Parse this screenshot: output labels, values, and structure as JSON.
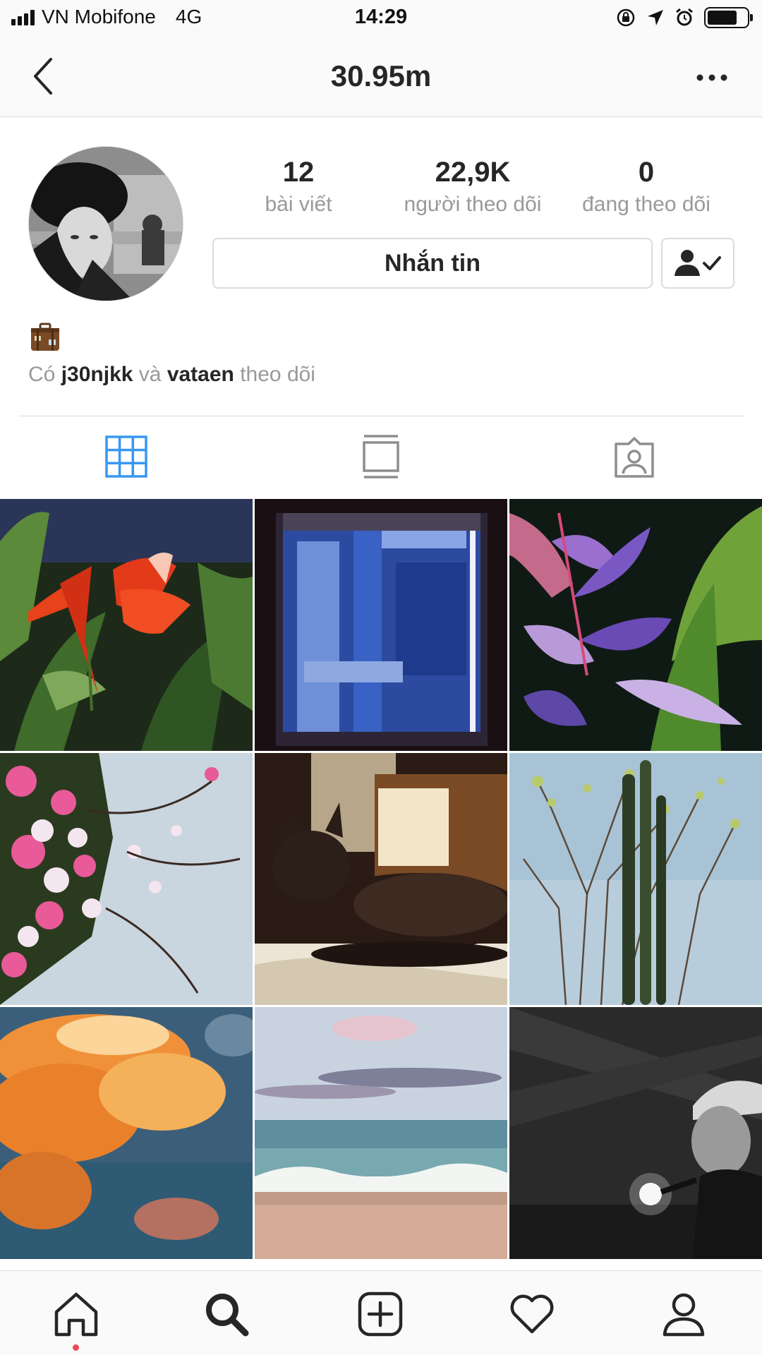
{
  "status_bar": {
    "carrier": "VN Mobifone",
    "network": "4G",
    "time": "14:29",
    "battery_level": 0.75,
    "icons": [
      "orientation-lock-icon",
      "location-arrow-icon",
      "alarm-icon",
      "battery-icon"
    ]
  },
  "nav": {
    "title": "30.95m",
    "back_icon": "chevron-left-icon",
    "more_icon": "more-horizontal-icon"
  },
  "profile": {
    "stats": [
      {
        "value": "12",
        "label": "bài viết"
      },
      {
        "value": "22,9K",
        "label": "người theo dõi"
      },
      {
        "value": "0",
        "label": "đang theo dõi"
      }
    ],
    "message_button": "Nhắn tin",
    "follow_icon": "person-check-icon",
    "bio_icon": "suitcase-icon",
    "followed_by": {
      "prefix": "Có",
      "user1": "j30njkk",
      "joiner": "và",
      "user2": "vataen",
      "suffix": "theo dõi"
    }
  },
  "tabs": [
    {
      "icon": "grid-icon",
      "active": true
    },
    {
      "icon": "feed-icon",
      "active": false
    },
    {
      "icon": "tagged-icon",
      "active": false
    }
  ],
  "colors": {
    "accent": "#3897f0",
    "inactive_icon": "#8e8e8e",
    "notification_dot": "#ed4956"
  },
  "posts": [
    {
      "subject": "red heliconia flowers"
    },
    {
      "subject": "blue abstract light"
    },
    {
      "subject": "purple tropical leaves"
    },
    {
      "subject": "pink bougainvillea branches"
    },
    {
      "subject": "black cat in sunlight"
    },
    {
      "subject": "bare tree and cactus"
    },
    {
      "subject": "orange sunset clouds"
    },
    {
      "subject": "ocean waves at beach"
    },
    {
      "subject": "singer with cap performing"
    }
  ],
  "bottom_tabs": [
    {
      "icon": "home-icon",
      "active": true
    },
    {
      "icon": "search-icon",
      "active": false
    },
    {
      "icon": "add-post-icon",
      "active": false
    },
    {
      "icon": "heart-icon",
      "active": false
    },
    {
      "icon": "profile-icon",
      "active": false
    }
  ]
}
